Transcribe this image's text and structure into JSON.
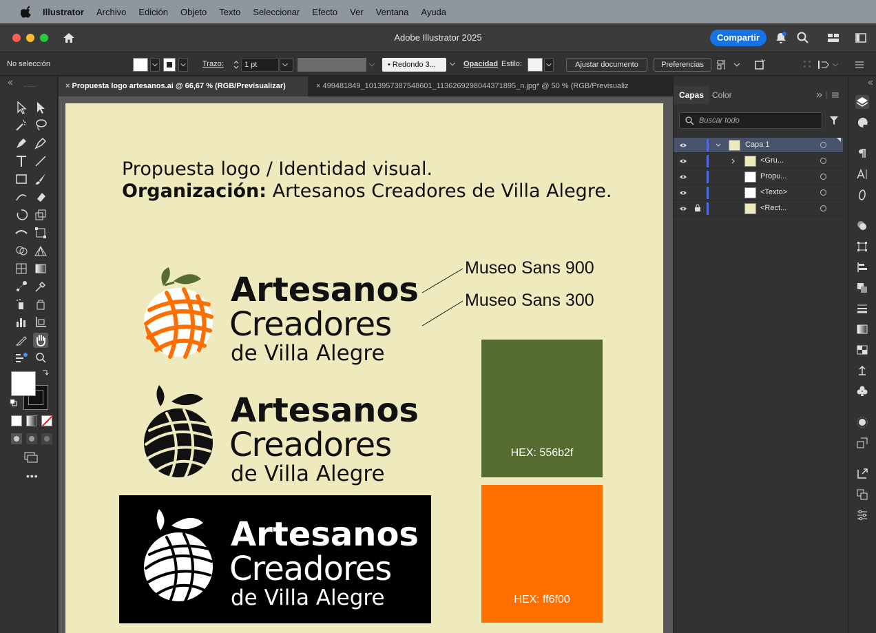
{
  "menubar": {
    "items": [
      "Illustrator",
      "Archivo",
      "Edición",
      "Objeto",
      "Texto",
      "Seleccionar",
      "Efecto",
      "Ver",
      "Ventana",
      "Ayuda"
    ]
  },
  "titlebar": {
    "title": "Adobe Illustrator 2025",
    "share_label": "Compartir"
  },
  "controlbar": {
    "selection": "No selección",
    "stroke_label": "Trazo:",
    "stroke_value": "1 pt",
    "brush_value": "Redondo 3...",
    "opacity_label": "Opacidad",
    "style_label": "Estilo:",
    "fit_button": "Ajustar documento",
    "prefs_button": "Preferencias"
  },
  "tabs": {
    "active": "Propuesta logo artesanos.ai @ 66,67 % (RGB/Previsualizar)",
    "inactive": "499481849_1013957387548601_1136269298044371895_n.jpg* @ 50 % (RGB/Previsualiz"
  },
  "artboard": {
    "heading_line1": "Propuesta logo / Identidad visual.",
    "heading_bold": "Organización:",
    "heading_rest": " Artesanos Creadores de Villa Alegre.",
    "logo_word1": "Artesanos",
    "logo_word2": "Creadores",
    "logo_word3": "de Villa Alegre",
    "font_note1": "Museo Sans 900",
    "font_note2": "Museo Sans 300",
    "color1_hex_label": "HEX: 556b2f",
    "color2_hex_label": "HEX: ff6f00",
    "colors": {
      "green": "#556b2f",
      "orange": "#ff6f00",
      "artboard": "#efeabd"
    }
  },
  "layers_panel": {
    "tab_layers": "Capas",
    "tab_color": "Color",
    "search_placeholder": "Buscar todo",
    "rows": [
      {
        "name": "Capa 1"
      },
      {
        "name": "<Gru..."
      },
      {
        "name": "Propu..."
      },
      {
        "name": "<Texto>"
      },
      {
        "name": "<Rect..."
      }
    ]
  }
}
